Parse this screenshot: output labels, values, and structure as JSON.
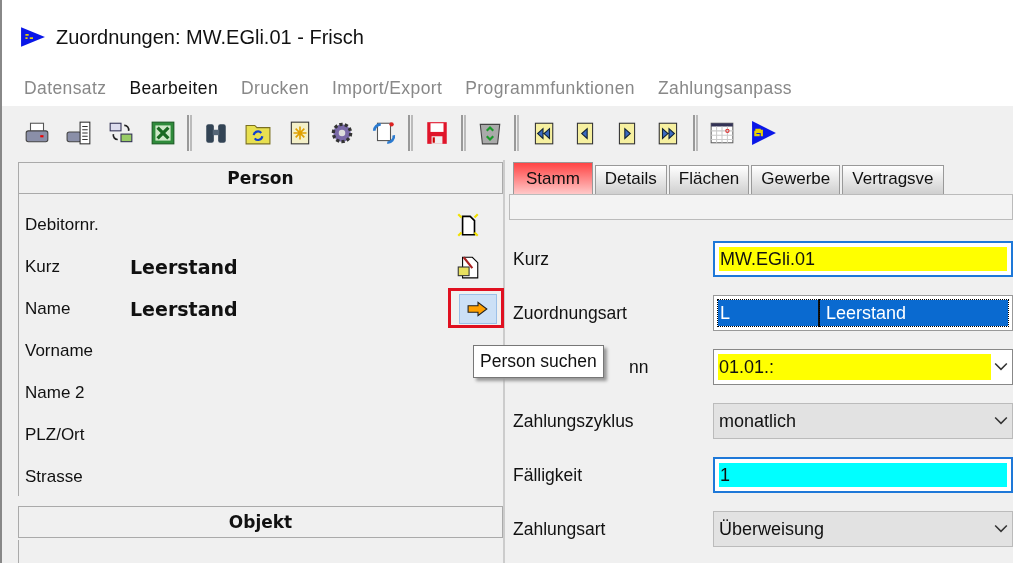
{
  "window": {
    "title": "Zuordnungen: MW.EGli.01 - Frisch"
  },
  "menu": [
    {
      "label": "Datensatz",
      "disabled": true
    },
    {
      "label": "Bearbeiten",
      "disabled": false
    },
    {
      "label": "Drucken",
      "disabled": true
    },
    {
      "label": "Import/Export",
      "disabled": true
    },
    {
      "label": "Programmfunktionen",
      "disabled": true
    },
    {
      "label": "Zahlungsanpass",
      "disabled": true
    }
  ],
  "toolbar": [
    {
      "kind": "printer"
    },
    {
      "kind": "print-preview"
    },
    {
      "kind": "mail-exchange"
    },
    {
      "kind": "spreadsheet"
    },
    {
      "kind": "sep"
    },
    {
      "kind": "binoculars"
    },
    {
      "kind": "folder-refresh"
    },
    {
      "kind": "new-sparkle"
    },
    {
      "kind": "gear"
    },
    {
      "kind": "doc-refresh"
    },
    {
      "kind": "sep"
    },
    {
      "kind": "save"
    },
    {
      "kind": "sep"
    },
    {
      "kind": "recycle"
    },
    {
      "kind": "sep"
    },
    {
      "kind": "first"
    },
    {
      "kind": "prev"
    },
    {
      "kind": "next"
    },
    {
      "kind": "last"
    },
    {
      "kind": "sep"
    },
    {
      "kind": "calendar"
    },
    {
      "kind": "si"
    }
  ],
  "person": {
    "title": "Person",
    "rows": [
      {
        "label": "Debitornr.",
        "kind": "new"
      },
      {
        "label": "Kurz",
        "value": "Leerstand",
        "kind": "edit"
      },
      {
        "label": "Name",
        "value": "Leerstand",
        "kind": "search"
      },
      {
        "label": "Vorname"
      },
      {
        "label": "Name 2"
      },
      {
        "label": "PLZ/Ort"
      },
      {
        "label": "Strasse"
      }
    ]
  },
  "objekt": {
    "title": "Objekt"
  },
  "tooltip": "Person suchen",
  "tabs": [
    {
      "label": "Stamm",
      "selected": true
    },
    {
      "label": "Details",
      "selected": false
    },
    {
      "label": "Flächen",
      "selected": false
    },
    {
      "label": "Gewerbe",
      "selected": false
    },
    {
      "label": "Vertragsve",
      "selected": false
    }
  ],
  "form": [
    {
      "label": "Kurz",
      "kind": "text",
      "value": "MW.EGli.01",
      "color": "#ffff00"
    },
    {
      "label": "Zuordnungsart",
      "kind": "code",
      "code": "L",
      "value": "Leerstand"
    },
    {
      "label": "nn",
      "kind": "dropdown",
      "value": "01.01.:",
      "color": "#ffff00",
      "disabled": false,
      "covered": true
    },
    {
      "label": "Zahlungszyklus",
      "kind": "dropdown",
      "value": "monatlich",
      "disabled": true
    },
    {
      "label": "Fälligkeit",
      "kind": "text",
      "value": "1",
      "color": "#00ffff"
    },
    {
      "label": "Zahlungsart",
      "kind": "dropdown",
      "value": "Überweisung",
      "disabled": true
    }
  ]
}
